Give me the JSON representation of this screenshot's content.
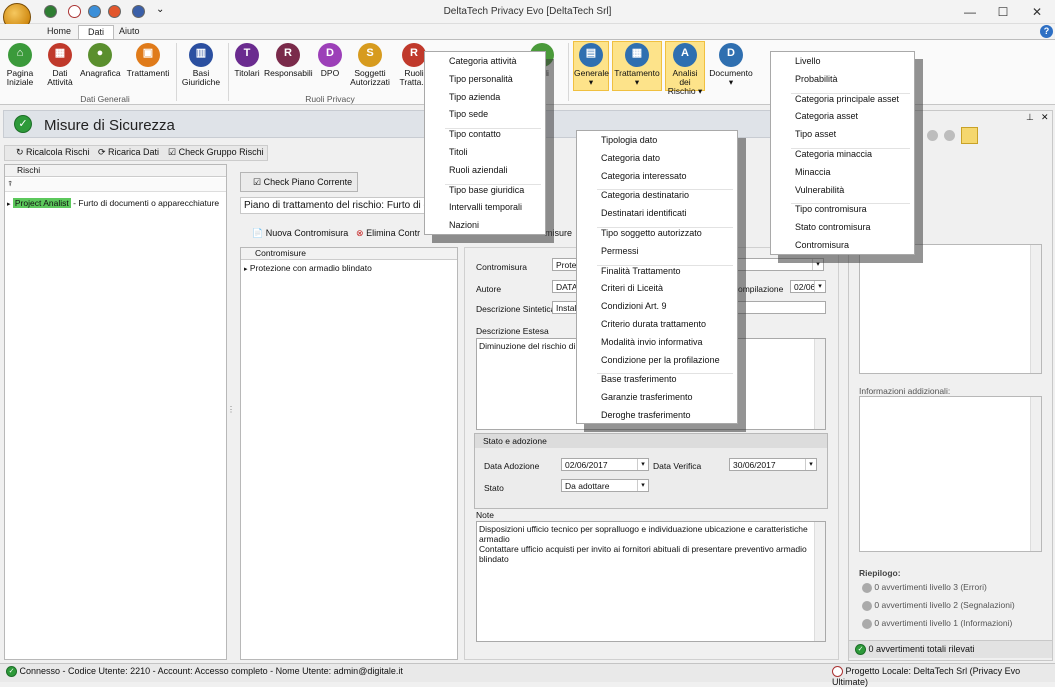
{
  "window": {
    "title": "DeltaTech Privacy Evo [DeltaTech Srl]",
    "minimize": "—",
    "maximize": "☐",
    "close": "✕",
    "help": "?"
  },
  "ribbon_tabs": [
    "Home",
    "Dati",
    "Aiuto"
  ],
  "ribbon": {
    "dati_generali": {
      "label": "Dati Generali",
      "buttons": [
        {
          "label1": "Pagina",
          "label2": "Iniziale"
        },
        {
          "label1": "Dati",
          "label2": "Attività"
        },
        {
          "label1": "Anagrafica",
          "label2": ""
        },
        {
          "label1": "Trattamenti",
          "label2": ""
        },
        {
          "label1": "Basi",
          "label2": "Giuridiche"
        }
      ]
    },
    "ruoli_privacy": {
      "label": "Ruoli Privacy",
      "buttons": [
        {
          "label1": "Titolari",
          "label2": ""
        },
        {
          "label1": "Responsabili",
          "label2": ""
        },
        {
          "label1": "DPO",
          "label2": ""
        },
        {
          "label1": "Soggetti",
          "label2": "Autorizzati"
        },
        {
          "label1": "Ruoli",
          "label2": "Tratta..."
        }
      ]
    },
    "partial_button": {
      "label1": "e di",
      "label2": "o"
    },
    "tabelle_buttons": [
      {
        "label1": "Generale",
        "label2": "▾"
      },
      {
        "label1": "Trattamento",
        "label2": "▾"
      },
      {
        "label1": "Analisi dei",
        "label2": "Rischio ▾"
      },
      {
        "label1": "Documento",
        "label2": "▾"
      }
    ]
  },
  "pane": {
    "title": "Misure di Sicurezza"
  },
  "toolbar": {
    "ricalcola": "Ricalcola Rischi",
    "ricarica": "Ricarica Dati",
    "check_gruppo": "Check Gruppo Rischi"
  },
  "rischi_grid": {
    "header": "Rischi",
    "filter_icon": "⍒",
    "row": {
      "tag": "Project Analist",
      "text": " - Furto di documenti o apparecchiature"
    }
  },
  "check_piano": "Check Piano Corrente",
  "piano_title": "Piano di trattamento del rischio: Furto di d",
  "contromisure_toolbar": {
    "nuova": "Nuova Contromisura",
    "elimina": "Elimina Contr",
    "misure_tail": "misure"
  },
  "contromisure_grid": {
    "header": "Contromisure",
    "row": "Protezione con armadio blindato"
  },
  "form": {
    "contromisura_label": "Contromisura",
    "contromisura_value": "Prote",
    "autore_label": "Autore",
    "autore_value": "DATA",
    "compilazione_label": "ompilazione",
    "compilazione_value": "02/06",
    "descr_sintetica_label": "Descrizione Sintetica",
    "descr_sintetica_value": "Install",
    "descr_estesa_label": "Descrizione Estesa",
    "descr_estesa_value": "Diminuzione del rischio di div",
    "stato_group": "Stato e adozione",
    "data_adozione_label": "Data Adozione",
    "data_adozione_value": "02/06/2017",
    "data_verifica_label": "Data Verifica",
    "data_verifica_value": "30/06/2017",
    "stato_label": "Stato",
    "stato_value": "Da adottare",
    "note_label": "Note",
    "note_value": "Disposizioni ufficio tecnico per sopralluogo e individuazione ubicazione e caratteristiche armadio\nContattare ufficio acquisti per invito ai fornitori abituali di presentare preventivo armadio blindato"
  },
  "right_panel": {
    "info_label": "Informazioni addizionali:",
    "riepilogo_label": "Riepilogo:",
    "livello3": "0 avvertimenti livello 3 (Errori)",
    "livello2": "0 avvertimenti livello 2 (Segnalazioni)",
    "livello1": "0 avvertimenti livello 1 (Informazioni)",
    "totali": "0 avvertimenti totali rilevati",
    "pin": "⊥",
    "close": "✕"
  },
  "menu_generale": {
    "groups": [
      [
        "Categoria attività",
        "Tipo personalità",
        "Tipo azienda",
        "Tipo sede"
      ],
      [
        "Tipo contatto",
        "Titoli",
        "Ruoli aziendali"
      ],
      [
        "Tipo base giuridica",
        "Intervalli temporali",
        "Nazioni"
      ]
    ]
  },
  "menu_trattamento": {
    "groups": [
      [
        "Tipologia dato",
        "Categoria dato",
        "Categoria interessato"
      ],
      [
        "Categoria destinatario",
        "Destinatari identificati"
      ],
      [
        "Tipo soggetto autorizzato",
        "Permessi"
      ],
      [
        "Finalità Trattamento",
        "Criteri di Liceità",
        "Condizioni Art. 9",
        "Criterio durata trattamento",
        "Modalità invio informativa",
        "Condizione per la profilazione"
      ],
      [
        "Base trasferimento",
        "Garanzie trasferimento",
        "Deroghe trasferimento"
      ]
    ]
  },
  "menu_analisi": {
    "groups": [
      [
        "Livello",
        "Probabilità"
      ],
      [
        "Categoria principale asset",
        "Categoria asset",
        "Tipo asset"
      ],
      [
        "Categoria minaccia",
        "Minaccia",
        "Vulnerabilità"
      ],
      [
        "Tipo contromisura",
        "Stato contromisura",
        "Contromisura"
      ]
    ]
  },
  "status": {
    "left": "Connesso - Codice Utente: 2210 - Account: Accesso completo - Nome Utente: admin@digitale.it",
    "right": "Progetto Locale: DeltaTech Srl (Privacy Evo Ultimate)"
  },
  "colors": {
    "highlight": "#fde38a",
    "green": "#2e9a3a",
    "selected_row": "#5cc85c"
  }
}
